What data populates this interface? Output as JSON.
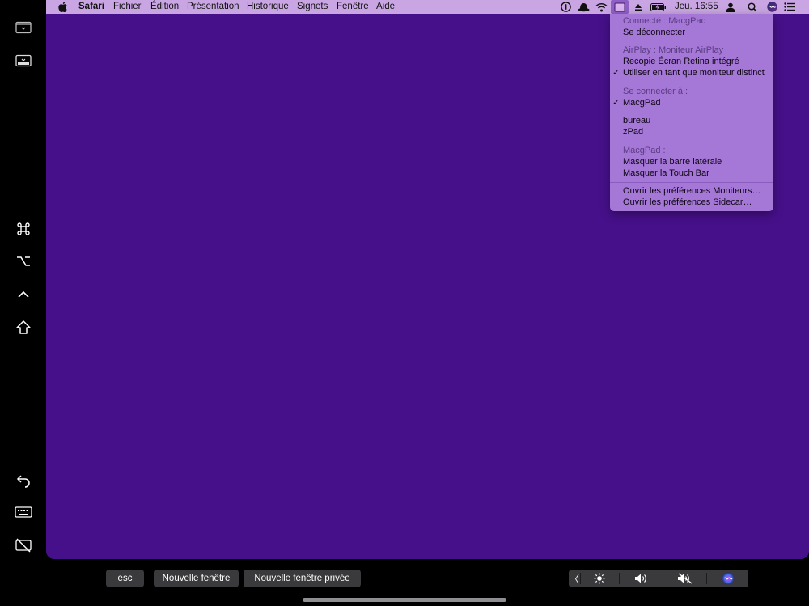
{
  "menubar": {
    "app_name": "Safari",
    "menus": [
      "Fichier",
      "Édition",
      "Présentation",
      "Historique",
      "Signets",
      "Fenêtre",
      "Aide"
    ],
    "clock": "Jeu. 16:55",
    "status_icons": [
      "1password-icon",
      "hat-icon",
      "wifi-icon",
      "sidecar-display-icon",
      "eject-icon",
      "battery-icon",
      "clock",
      "user-icon",
      "search-icon",
      "siri-icon",
      "control-center-icon"
    ]
  },
  "dropdown": {
    "connected_header": "Connecté : MacgPad",
    "disconnect": "Se déconnecter",
    "airplay_header": "AirPlay : Moniteur AirPlay",
    "mirror": "Recopie Écran Retina intégré",
    "separate": "Utiliser en tant que moniteur distinct",
    "connect_header": "Se connecter à :",
    "device_macgpad": "MacgPad",
    "device_bureau": "bureau",
    "device_zpad": "zPad",
    "macgpad_header": "MacgPad :",
    "hide_sidebar": "Masquer la barre latérale",
    "hide_touchbar": "Masquer la Touch Bar",
    "prefs_displays": "Ouvrir les préférences Moniteurs…",
    "prefs_sidecar": "Ouvrir les préférences Sidecar…",
    "checkmark": "✓"
  },
  "touchbar": {
    "esc": "esc",
    "new_window": "Nouvelle fenêtre",
    "new_private_window": "Nouvelle fenêtre privée",
    "collapse_glyph": "〈"
  },
  "sidebar": {
    "icons": [
      "menubar-toggle-icon",
      "dock-toggle-icon",
      "command-icon",
      "option-icon",
      "control-icon",
      "shift-icon",
      "undo-icon",
      "keyboard-icon",
      "disconnect-display-icon"
    ]
  },
  "colors": {
    "desktop": "#46108a",
    "menubar": "#c9a6e3",
    "menu": "#a577d6"
  }
}
